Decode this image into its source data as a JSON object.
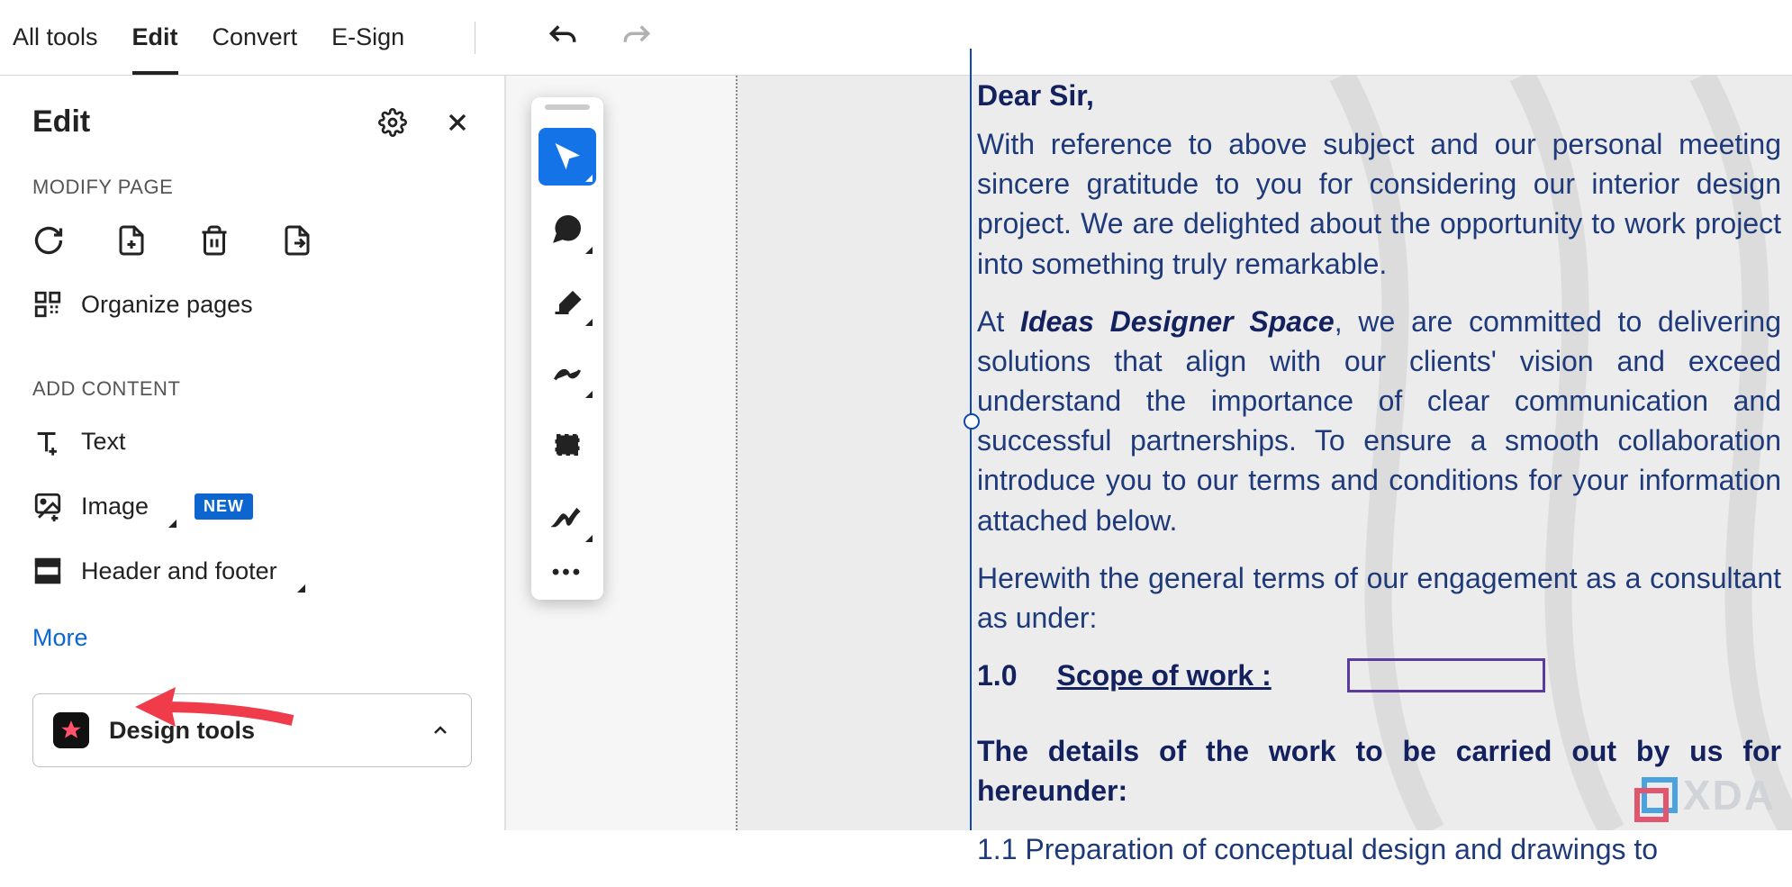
{
  "topbar": {
    "all_tools": "All tools",
    "edit": "Edit",
    "convert": "Convert",
    "esign": "E-Sign"
  },
  "sidepanel": {
    "title": "Edit",
    "section_modify": "MODIFY PAGE",
    "organize_pages": "Organize pages",
    "section_add": "ADD CONTENT",
    "text": "Text",
    "image": "Image",
    "image_badge": "NEW",
    "header_footer": "Header and footer",
    "more": "More",
    "design_tools": "Design tools"
  },
  "document": {
    "greeting": "Dear Sir,",
    "p1": "With reference to above subject and our personal meeting sincere gratitude to you for considering our interior design project. We are delighted about the opportunity to work project into something truly remarkable.",
    "p2_pre": "At ",
    "company": "Ideas Designer Space",
    "p2_post": ", we are committed to delivering solutions that align with our clients' vision and exceed understand the importance of clear communication and successful partnerships. To ensure a smooth collaboration introduce you to our terms and conditions for your information attached below.",
    "p3": "Herewith the general terms of our engagement as a consultant as under:",
    "scope_num": "1.0",
    "scope_title": "Scope of work :",
    "details_head": "The details of the work to be carried out by us for hereunder:",
    "prep": "1.1 Preparation of conceptual design and drawings to"
  },
  "branding": {
    "xda": "XDA"
  }
}
